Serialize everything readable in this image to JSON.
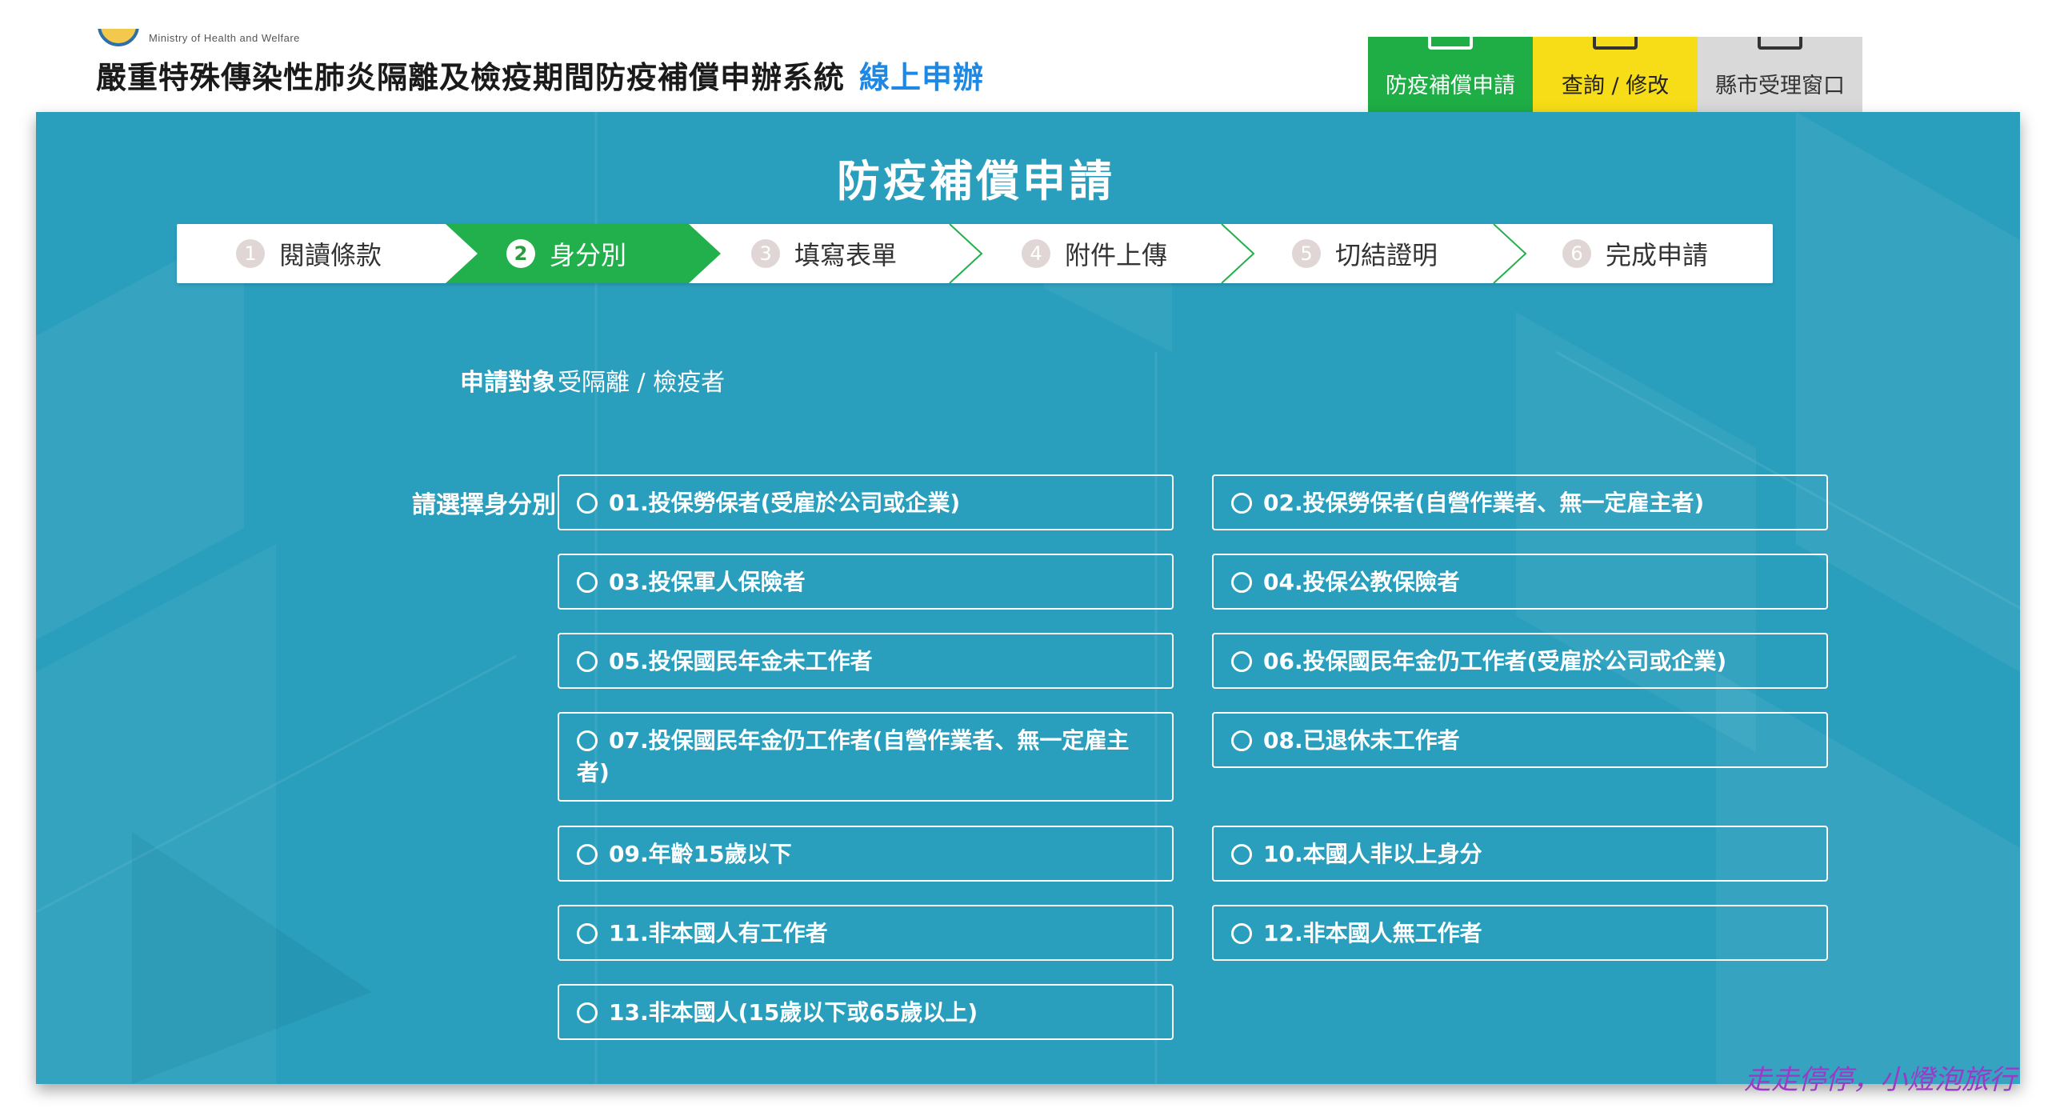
{
  "header": {
    "ministry_en": "Ministry of Health and Welfare",
    "title": "嚴重特殊傳染性肺炎隔離及檢疫期間防疫補償申辦系統",
    "title_highlight": "線上申辦",
    "nav": [
      {
        "label": "防疫補償申請",
        "icon": "computer-icon",
        "color": "#1fae45"
      },
      {
        "label": "查詢 / 修改",
        "icon": "document-search-icon",
        "color": "#f7dd17"
      },
      {
        "label": "縣市受理窗口",
        "icon": "counter-icon",
        "color": "#d9d9d9"
      }
    ]
  },
  "main": {
    "heading": "防疫補償申請",
    "steps": [
      {
        "num": "1",
        "label": "閱讀條款"
      },
      {
        "num": "2",
        "label": "身分別"
      },
      {
        "num": "3",
        "label": "填寫表單"
      },
      {
        "num": "4",
        "label": "附件上傳"
      },
      {
        "num": "5",
        "label": "切結證明"
      },
      {
        "num": "6",
        "label": "完成申請"
      }
    ],
    "active_step": "2",
    "target_label": "申請對象",
    "target_value": "受隔離 / 檢疫者",
    "identity_label": "請選擇身分別",
    "options": [
      "01.投保勞保者(受雇於公司或企業)",
      "02.投保勞保者(自營作業者、無一定雇主者)",
      "03.投保軍人保險者",
      "04.投保公教保險者",
      "05.投保國民年金未工作者",
      "06.投保國民年金仍工作者(受雇於公司或企業)",
      "07.投保國民年金仍工作者(自營作業者、無一定雇主者)",
      "08.已退休未工作者",
      "09.年齡15歲以下",
      "10.本國人非以上身分",
      "11.非本國人有工作者",
      "12.非本國人無工作者",
      "13.非本國人(15歲以下或65歲以上)"
    ],
    "colors": {
      "panel": "#2a9fbd",
      "active_step": "#21b04b",
      "title_highlight": "#1e88e5"
    }
  },
  "watermark": "走走停停，小燈泡旅行"
}
